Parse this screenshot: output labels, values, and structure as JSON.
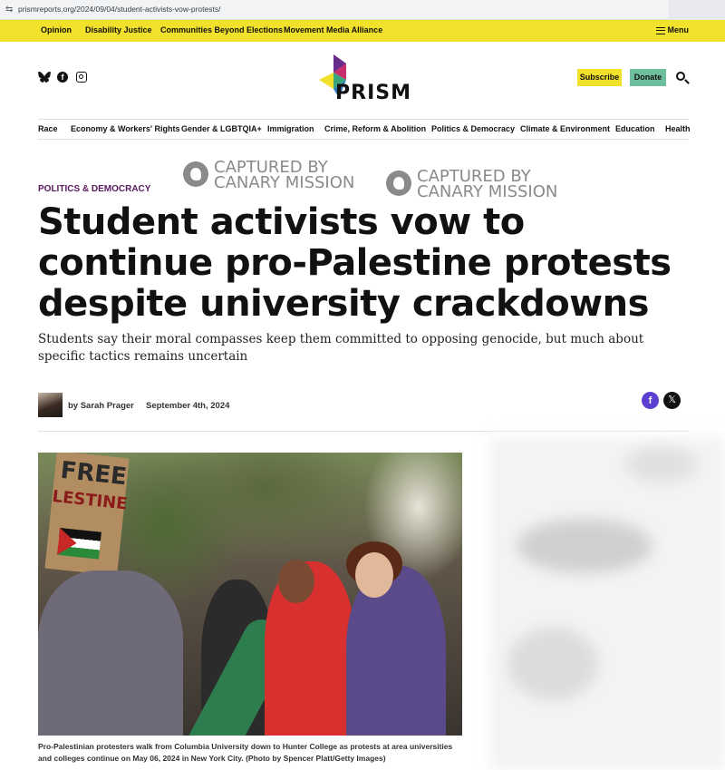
{
  "browser": {
    "url": "prismreports.org/2024/09/04/student-activists-vow-protests/"
  },
  "topnav": {
    "items": [
      "Opinion",
      "Disability Justice",
      "Communities Beyond Elections",
      "Movement Media Alliance"
    ],
    "menu_label": "Menu"
  },
  "header": {
    "logo_text": "PRISM",
    "subscribe_label": "Subscribe",
    "donate_label": "Donate",
    "social_icons": [
      "bluesky-icon",
      "facebook-icon",
      "instagram-icon"
    ]
  },
  "secnav": {
    "items": [
      "Race",
      "Economy & Workers' Rights",
      "Gender & LGBTQIA+",
      "Immigration",
      "Crime, Reform & Abolition",
      "Politics & Democracy",
      "Climate & Environment",
      "Education",
      "Health"
    ]
  },
  "watermark": {
    "line1": "CAPTURED BY",
    "line2": "CANARY MISSION"
  },
  "article": {
    "kicker": "POLITICS & DEMOCRACY",
    "title": "Student activists vow to continue pro-Palestine protests despite university crackdowns",
    "dek": "Students say their moral compasses keep them committed to opposing genocide, but much about specific tactics remains uncertain",
    "byline": "by Sarah Prager",
    "date": "September 4th, 2024",
    "photo_sign": {
      "line1": "FREE",
      "line2": "LESTINE"
    },
    "caption": "Pro-Palestinian protesters walk from Columbia University down to Hunter College as protests at area universities and colleges continue on May 06, 2024 in New York City. (Photo by Spencer Platt/Getty Images)"
  },
  "colors": {
    "nav_yellow": "#f1e12b",
    "donate_green": "#6dbf9e",
    "kicker_purple": "#5a1a5e",
    "share_facebook": "#5c3fd1"
  }
}
